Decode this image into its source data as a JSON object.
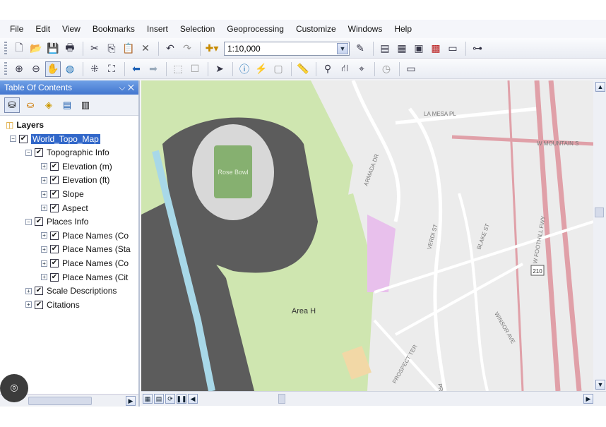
{
  "menu": [
    "File",
    "Edit",
    "View",
    "Bookmarks",
    "Insert",
    "Selection",
    "Geoprocessing",
    "Customize",
    "Windows",
    "Help"
  ],
  "toolbar": {
    "scale_value": "1:10,000"
  },
  "toc": {
    "title": "Table Of Contents",
    "pin_close": "⌵ ✕",
    "items": [
      {
        "label": "Layers",
        "level": 0,
        "checkbox": false,
        "expander": "",
        "bold": true
      },
      {
        "label": "World_Topo_Map",
        "level": 1,
        "checkbox": true,
        "expander": "−",
        "selected": true
      },
      {
        "label": "Topographic Info",
        "level": 2,
        "checkbox": true,
        "expander": "−"
      },
      {
        "label": "Elevation (m)",
        "level": 3,
        "checkbox": true,
        "expander": "+"
      },
      {
        "label": "Elevation (ft)",
        "level": 3,
        "checkbox": true,
        "expander": "+"
      },
      {
        "label": "Slope",
        "level": 3,
        "checkbox": true,
        "expander": "+"
      },
      {
        "label": "Aspect",
        "level": 3,
        "checkbox": true,
        "expander": "+"
      },
      {
        "label": "Places Info",
        "level": 2,
        "checkbox": true,
        "expander": "−"
      },
      {
        "label": "Place Names (Co",
        "level": 3,
        "checkbox": true,
        "expander": "+"
      },
      {
        "label": "Place Names (Sta",
        "level": 3,
        "checkbox": true,
        "expander": "+"
      },
      {
        "label": "Place Names (Co",
        "level": 3,
        "checkbox": true,
        "expander": "+"
      },
      {
        "label": "Place Names (Cit",
        "level": 3,
        "checkbox": true,
        "expander": "+"
      },
      {
        "label": "Scale Descriptions",
        "level": 2,
        "checkbox": true,
        "expander": "+"
      },
      {
        "label": "Citations",
        "level": 2,
        "checkbox": true,
        "expander": "+"
      }
    ]
  },
  "map": {
    "labels": {
      "stadium": "Rose Bowl",
      "area": "Area H",
      "la_mesa": "LA MESA PL",
      "mountain": "W MOUNTAIN S",
      "armada": "ARMADA DR",
      "foothill": "W FOOTHILL FWY",
      "blake": "BLAKE ST",
      "prospect_ter": "PROSPECT TER",
      "prospect": "PROSPECT",
      "hwy": "210",
      "verdi": "VERDI ST",
      "windsor": "WINSOR AVE"
    },
    "colors": {
      "park": "#cfe6b0",
      "parking": "#5a5a5a",
      "road": "#ffffff",
      "major_road": "#e0a0a8",
      "school": "#e8c0ec",
      "land": "#ececec",
      "water": "#a8d8e8"
    }
  },
  "camera_icon": "camera-icon"
}
